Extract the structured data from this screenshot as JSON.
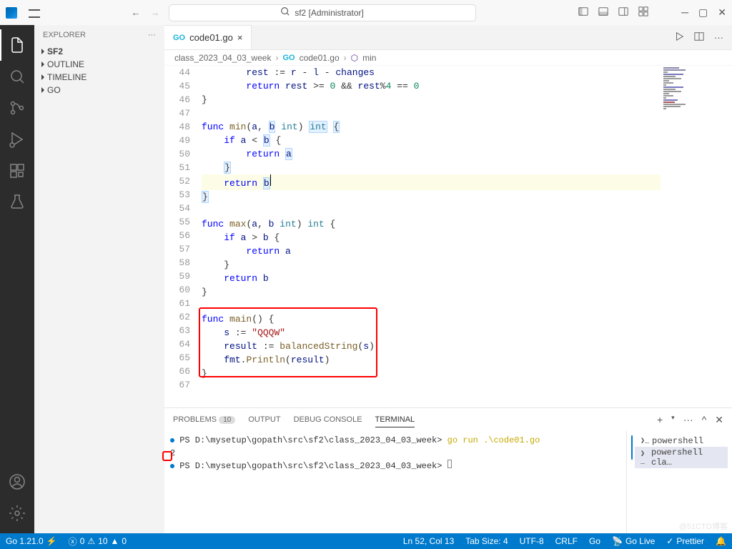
{
  "titlebar": {
    "search_placeholder": "sf2 [Administrator]"
  },
  "sidebar": {
    "title": "EXPLORER",
    "items": [
      "SF2",
      "OUTLINE",
      "TIMELINE",
      "GO"
    ]
  },
  "tabs": [
    {
      "icon_label": "GO",
      "name": "code01.go",
      "close": "×"
    }
  ],
  "breadcrumb": [
    "class_2023_04_03_week",
    "code01.go",
    "min"
  ],
  "code": {
    "start": 44,
    "lines": [
      "        rest := r - l - changes",
      "        return rest >= 0 && rest%4 == 0",
      "}",
      "",
      "func min(a, b int) int {",
      "    if a < b {",
      "        return a",
      "    }",
      "    return b",
      "}",
      "",
      "func max(a, b int) int {",
      "    if a > b {",
      "        return a",
      "    }",
      "    return b",
      "}",
      "",
      "func main() {",
      "    s := \"QQQW\"",
      "    result := balancedString(s)",
      "    fmt.Println(result)",
      "}",
      ""
    ]
  },
  "panel": {
    "tabs": [
      "PROBLEMS",
      "OUTPUT",
      "DEBUG CONSOLE",
      "TERMINAL"
    ],
    "problems_count": "10",
    "terminal": {
      "line1_prompt": "PS D:\\mysetup\\gopath\\src\\sf2\\class_2023_04_03_week>",
      "line1_cmd": "go run .\\code01.go",
      "output": "2",
      "line2_prompt": "PS D:\\mysetup\\gopath\\src\\sf2\\class_2023_04_03_week>"
    },
    "termlist": [
      "powershell",
      "powershell  cla…"
    ]
  },
  "statusbar": {
    "go_version": "Go 1.21.0",
    "errors": "0",
    "warnings": "10",
    "triangle": "0",
    "cursor": "Ln 52, Col 13",
    "tab": "Tab Size: 4",
    "encoding": "UTF-8",
    "eol": "CRLF",
    "lang": "Go",
    "golive": "Go Live",
    "prettier": "Prettier"
  },
  "watermark": "@51CTO博客"
}
